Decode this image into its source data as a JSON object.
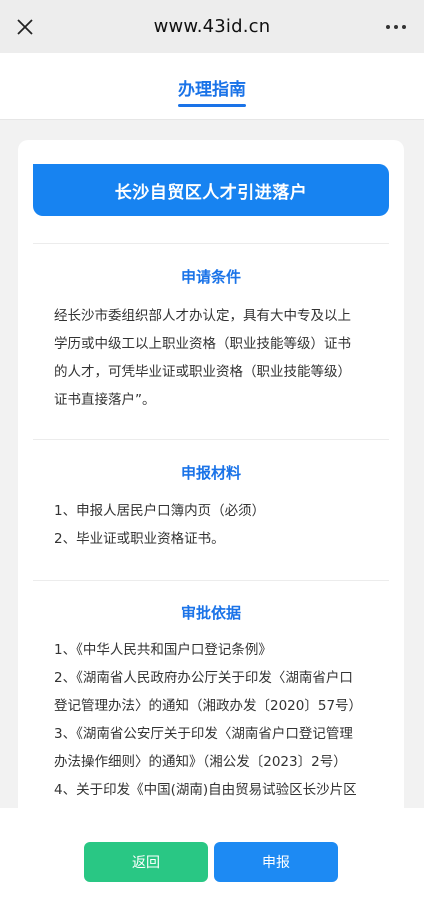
{
  "browser": {
    "url": "www.43id.cn"
  },
  "header": {
    "title": "办理指南"
  },
  "card": {
    "banner": "长沙自贸区人才引进落户",
    "sections": [
      {
        "title": "申请条件",
        "lines": [
          "经长沙市委组织部人才办认定，具有大中专及以上",
          "学历或中级工以上职业资格（职业技能等级）证书",
          "的人才，可凭毕业证或职业资格（职业技能等级）",
          "证书直接落户”。"
        ]
      },
      {
        "title": "申报材料",
        "items": [
          "1、申报人居民户口簿内页（必须）",
          "2、毕业证或职业资格证书。"
        ]
      },
      {
        "title": "审批依据",
        "items": [
          "1、《中华人民共和国户口登记条例》",
          "2、《湖南省人民政府办公厅关于印发〈湖南省户口",
          "登记管理办法〉的通知（湘政办发〔2020〕57号）",
          "3、《湖南省公安厅关于印发〈湖南省户口登记管理",
          "办法操作细则〉的通知》（湘公发〔2023〕2号）",
          "4、关于印发《中国(湖南)自由贸易试验区长沙片区"
        ]
      }
    ]
  },
  "buttons": {
    "back": "返回",
    "apply": "申报"
  },
  "colors": {
    "accent": "#1a73e8",
    "banner": "#1783f1",
    "back": "#29c784",
    "apply": "#1d8af3"
  }
}
